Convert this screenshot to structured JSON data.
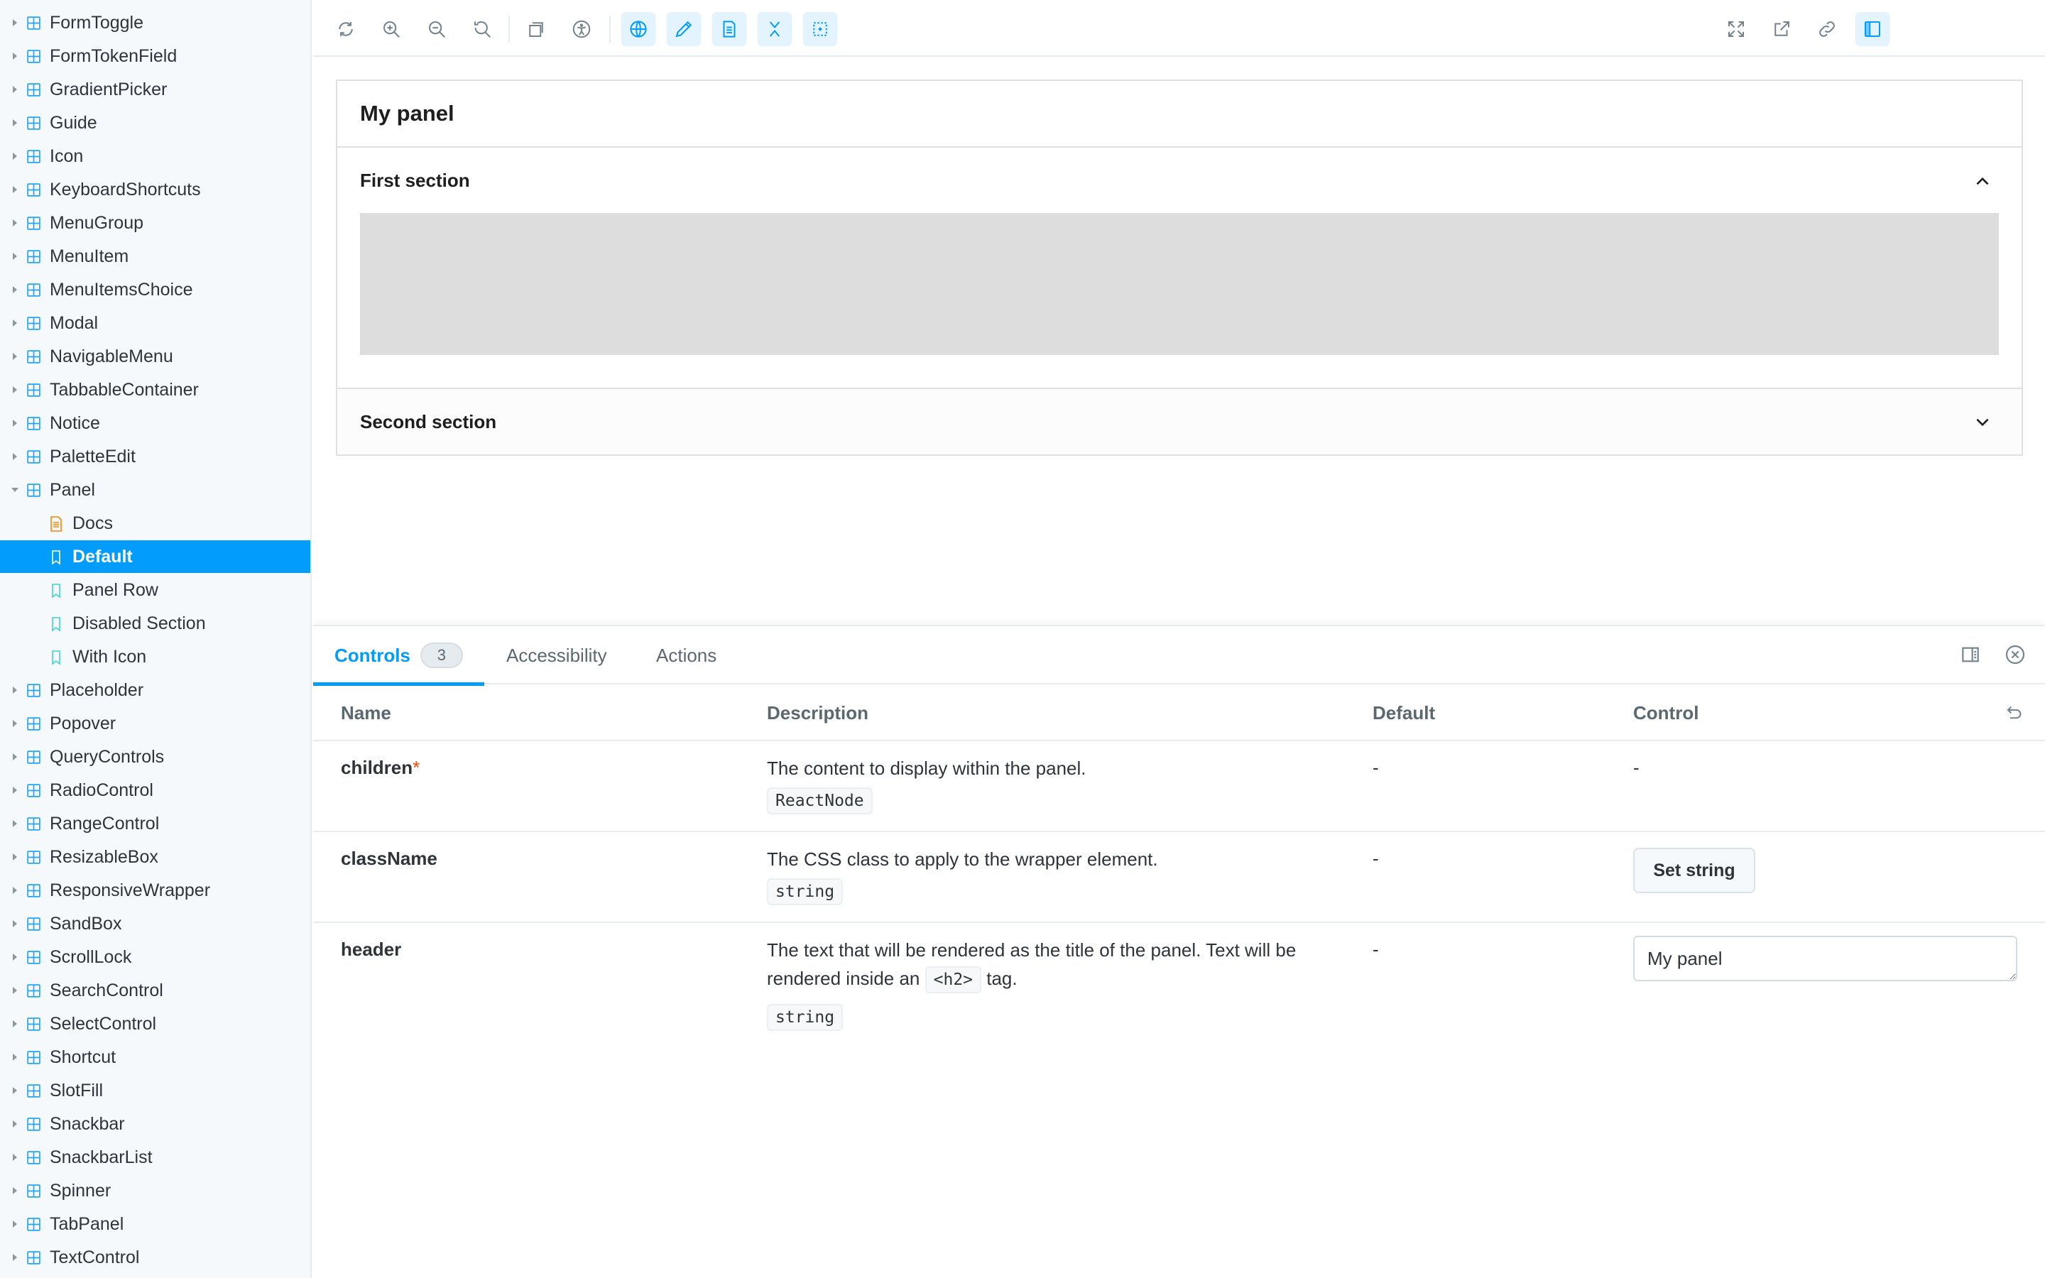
{
  "sidebar": {
    "items": [
      {
        "label": "FormToggle",
        "kind": "component"
      },
      {
        "label": "FormTokenField",
        "kind": "component"
      },
      {
        "label": "GradientPicker",
        "kind": "component"
      },
      {
        "label": "Guide",
        "kind": "component"
      },
      {
        "label": "Icon",
        "kind": "component"
      },
      {
        "label": "KeyboardShortcuts",
        "kind": "component"
      },
      {
        "label": "MenuGroup",
        "kind": "component"
      },
      {
        "label": "MenuItem",
        "kind": "component"
      },
      {
        "label": "MenuItemsChoice",
        "kind": "component"
      },
      {
        "label": "Modal",
        "kind": "component"
      },
      {
        "label": "NavigableMenu",
        "kind": "component"
      },
      {
        "label": "TabbableContainer",
        "kind": "component"
      },
      {
        "label": "Notice",
        "kind": "component"
      },
      {
        "label": "PaletteEdit",
        "kind": "component"
      },
      {
        "label": "Panel",
        "kind": "component",
        "expanded": true
      },
      {
        "label": "Docs",
        "kind": "docs"
      },
      {
        "label": "Default",
        "kind": "story",
        "selected": true
      },
      {
        "label": "Panel Row",
        "kind": "story"
      },
      {
        "label": "Disabled Section",
        "kind": "story"
      },
      {
        "label": "With Icon",
        "kind": "story"
      },
      {
        "label": "Placeholder",
        "kind": "component"
      },
      {
        "label": "Popover",
        "kind": "component"
      },
      {
        "label": "QueryControls",
        "kind": "component"
      },
      {
        "label": "RadioControl",
        "kind": "component"
      },
      {
        "label": "RangeControl",
        "kind": "component"
      },
      {
        "label": "ResizableBox",
        "kind": "component"
      },
      {
        "label": "ResponsiveWrapper",
        "kind": "component"
      },
      {
        "label": "SandBox",
        "kind": "component"
      },
      {
        "label": "ScrollLock",
        "kind": "component"
      },
      {
        "label": "SearchControl",
        "kind": "component"
      },
      {
        "label": "SelectControl",
        "kind": "component"
      },
      {
        "label": "Shortcut",
        "kind": "component"
      },
      {
        "label": "SlotFill",
        "kind": "component"
      },
      {
        "label": "Snackbar",
        "kind": "component"
      },
      {
        "label": "SnackbarList",
        "kind": "component"
      },
      {
        "label": "Spinner",
        "kind": "component"
      },
      {
        "label": "TabPanel",
        "kind": "component"
      },
      {
        "label": "TextControl",
        "kind": "component"
      }
    ]
  },
  "toolbar": {
    "left_tools": [
      "reload-icon",
      "zoom-in-icon",
      "zoom-out-icon",
      "zoom-reset-icon",
      "background-icon",
      "accessibility-icon",
      "globe-icon",
      "pencil-icon",
      "document-icon",
      "collapse-icon",
      "outline-icon"
    ],
    "active_tools": [
      "globe-icon",
      "pencil-icon",
      "document-icon",
      "collapse-icon",
      "outline-icon"
    ],
    "right_tools": [
      "fullscreen-icon",
      "open-new-tab-icon",
      "copy-link-icon",
      "panel-toggle-icon"
    ]
  },
  "canvas": {
    "panel_title": "My panel",
    "first_section": "First section",
    "second_section": "Second section"
  },
  "addons": {
    "tabs": {
      "controls": "Controls",
      "controls_count": "3",
      "accessibility": "Accessibility",
      "actions": "Actions"
    },
    "table": {
      "headers": {
        "name": "Name",
        "description": "Description",
        "default": "Default",
        "control": "Control"
      },
      "rows": [
        {
          "name": "children",
          "required_mark": "*",
          "description": "The content to display within the panel.",
          "type": "ReactNode",
          "default": "-",
          "control": "-"
        },
        {
          "name": "className",
          "description": "The CSS class to apply to the wrapper element.",
          "type": "string",
          "default": "-",
          "control_button": "Set string"
        },
        {
          "name": "header",
          "description_before": "The text that will be rendered as the title of the panel. Text will be rendered inside an",
          "description_code": "<h2>",
          "description_after": "tag.",
          "type": "string",
          "default": "-",
          "control_value": "My panel"
        }
      ]
    }
  },
  "colors": {
    "accent": "#029cfd",
    "sidebar_bg": "#f6f9fc",
    "component_icon": "#1ea7fd",
    "story_icon": "#37d5d3",
    "docs_icon": "#ff8300",
    "required": "#ff4400"
  }
}
